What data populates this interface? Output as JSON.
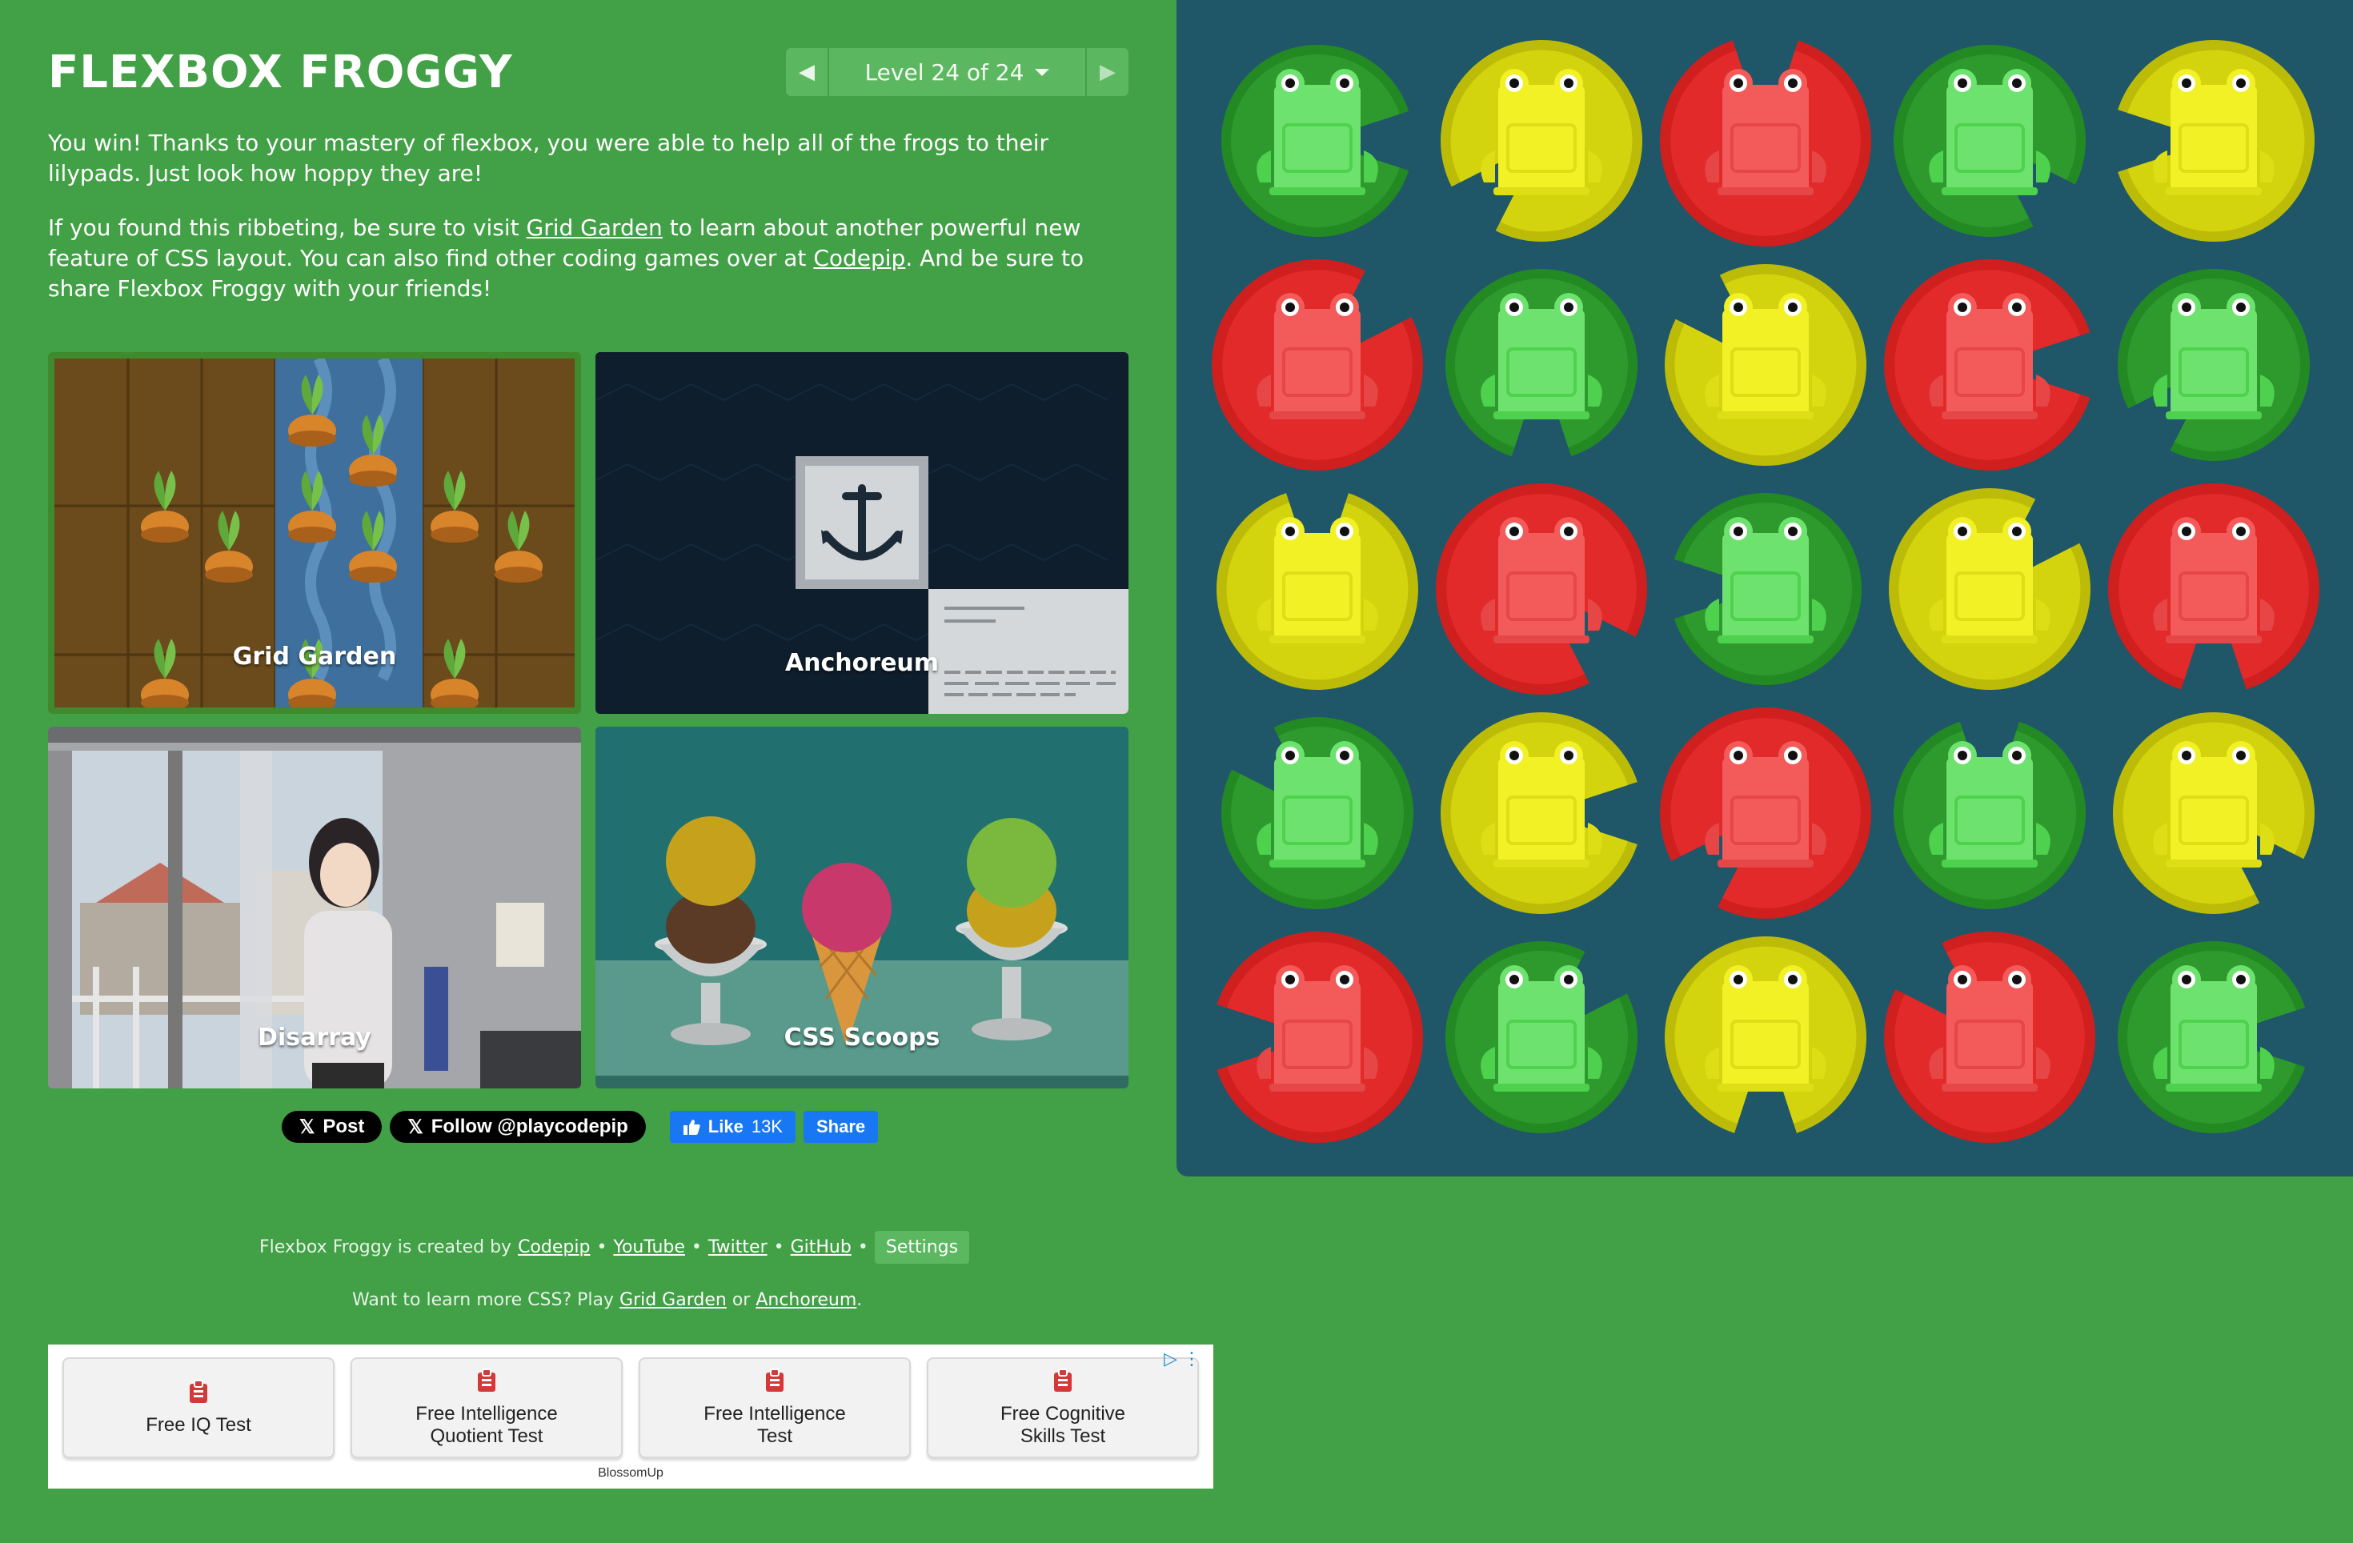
{
  "app": {
    "title": "FLEXBOX FROGGY"
  },
  "level_nav": {
    "label": "Level 24 of 24"
  },
  "intro": {
    "p1": "You win! Thanks to your mastery of flexbox, you were able to help all of the frogs to their lilypads. Just look how hoppy they are!",
    "p2_before": "If you found this ribbeting, be sure to visit ",
    "p2_link1": "Grid Garden",
    "p2_middle": " to learn about another powerful new feature of CSS layout. You can also find other coding games over at ",
    "p2_link2": "Codepip",
    "p2_after": ". And be sure to share Flexbox Froggy with your friends!"
  },
  "games": [
    {
      "label": "Grid Garden"
    },
    {
      "label": "Anchoreum"
    },
    {
      "label": "Disarray"
    },
    {
      "label": "CSS Scoops"
    }
  ],
  "social": {
    "post_label": "Post",
    "follow_label": "Follow @playcodepip",
    "like_label": "Like",
    "like_count": "13K",
    "share_label": "Share"
  },
  "footer": {
    "created_by": "Flexbox Froggy is created by",
    "codepip": "Codepip",
    "youtube": "YouTube",
    "twitter": "Twitter",
    "github": "GitHub",
    "settings": "Settings",
    "learn_before": "Want to learn more CSS? Play",
    "learn_link1": "Grid Garden",
    "learn_or": "or",
    "learn_link2": "Anchoreum",
    "learn_end": "."
  },
  "ad": {
    "items": [
      {
        "line1": "Free IQ Test",
        "line2": ""
      },
      {
        "line1": "Free Intelligence",
        "line2": "Quotient Test"
      },
      {
        "line1": "Free Intelligence",
        "line2": "Test"
      },
      {
        "line1": "Free Cognitive",
        "line2": "Skills Test"
      }
    ],
    "brand": "BlossomUp"
  },
  "board": {
    "colors": {
      "green": "#2e9a2e",
      "yellow": "#d4d40e",
      "red": "#e22a2a"
    },
    "frog_colors": {
      "green": "#6ee26e",
      "yellow": "#f1f126",
      "red": "#f35b5b"
    },
    "cells": [
      [
        "green",
        "yellow",
        "red",
        "green",
        "yellow"
      ],
      [
        "red",
        "green",
        "yellow",
        "red",
        "green"
      ],
      [
        "yellow",
        "red",
        "green",
        "yellow",
        "red"
      ],
      [
        "green",
        "yellow",
        "red",
        "green",
        "yellow"
      ],
      [
        "red",
        "green",
        "yellow",
        "red",
        "green"
      ]
    ]
  }
}
